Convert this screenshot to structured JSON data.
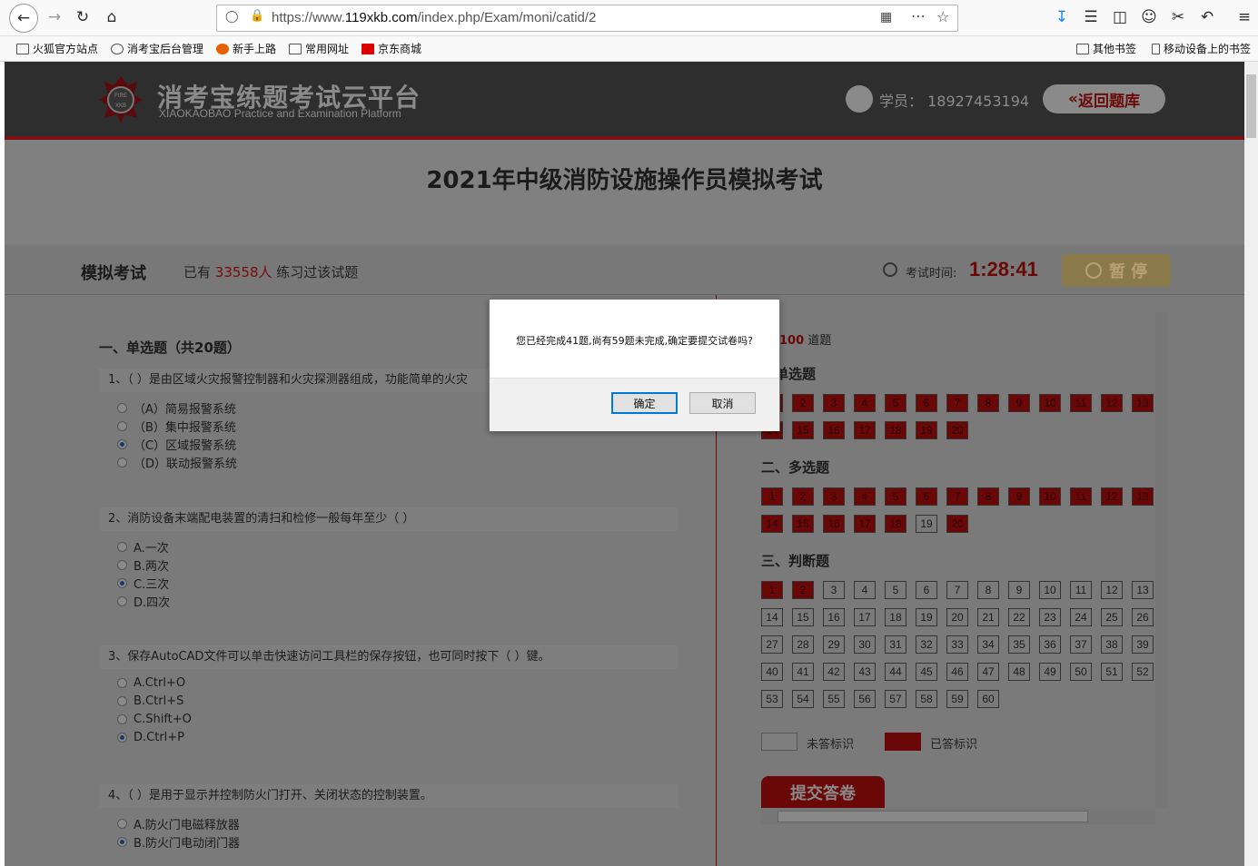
{
  "browser": {
    "url_prefix": "https://www.",
    "url_domain": "119xkb.com",
    "url_path": "/index.php/Exam/moni/catid/2",
    "bookmarks": [
      "火狐官方站点",
      "消考宝后台管理",
      "新手上路",
      "常用网址",
      "京东商城"
    ],
    "bookmarks_right": [
      "其他书签",
      "移动设备上的书签"
    ]
  },
  "header": {
    "logo_cn": "消考宝练题考试云平台",
    "logo_en": "XIAOKAOBAO Practice and Examination Platform",
    "student": "学员： 18927453194",
    "back_label": "返回题库"
  },
  "exam": {
    "title": "2021年中级消防设施操作员模拟考试",
    "mode": "模拟考试",
    "practiced_prefix": "已有",
    "practiced_count": "33558人",
    "practiced_suffix": "练习过该试题",
    "time_label": "考试时间:",
    "time": "1:28:41",
    "pause_label": "暂 停"
  },
  "questions": {
    "section": "一、单选题（共20题）",
    "items": [
      {
        "text": "1、（ ）是由区域火灾报警控制器和火灾探测器组成，功能简单的火灾",
        "options": [
          "（A）简易报警系统",
          "（B）集中报警系统",
          "（C）区域报警系统",
          "（D）联动报警系统"
        ],
        "selected": 2
      },
      {
        "text": "2、消防设备末端配电装置的清扫和检修一般每年至少（ ）",
        "options": [
          "A.一次",
          "B.两次",
          "C.三次",
          "D.四次"
        ],
        "selected": 2
      },
      {
        "text": "3、保存AutoCAD文件可以单击快速访问工具栏的保存按钮，也可同时按下（ ）键。",
        "options": [
          "A.Ctrl+O",
          "B.Ctrl+S",
          "C.Shift+O",
          "D.Ctrl+P"
        ],
        "selected": 3
      },
      {
        "text": "4、（ ）是用于显示并控制防火门打开、关闭状态的控制装置。",
        "options": [
          "A.防火门电磁释放器",
          "B.防火门电动闭门器"
        ],
        "selected": 1
      }
    ]
  },
  "answer_card": {
    "total_count": "100",
    "total_suffix": "道题",
    "sections": [
      {
        "title": "、单选题",
        "count": 20,
        "done": [
          1,
          2,
          3,
          4,
          5,
          6,
          7,
          8,
          9,
          10,
          11,
          12,
          13,
          14,
          15,
          16,
          17,
          18,
          19,
          20
        ]
      },
      {
        "title": "二、多选题",
        "count": 20,
        "done": [
          1,
          2,
          3,
          4,
          5,
          6,
          7,
          8,
          9,
          10,
          11,
          12,
          13,
          14,
          15,
          16,
          17,
          18,
          20
        ]
      },
      {
        "title": "三、判断题",
        "count": 60,
        "done": [
          1,
          2
        ]
      }
    ],
    "legend_unanswered": "未答标识",
    "legend_answered": "已答标识",
    "submit_label": "提交答卷"
  },
  "dialog": {
    "message": "您已经完成41题,尚有59题未完成,确定要提交试卷吗?",
    "ok_label": "确定",
    "cancel_label": "取消"
  }
}
